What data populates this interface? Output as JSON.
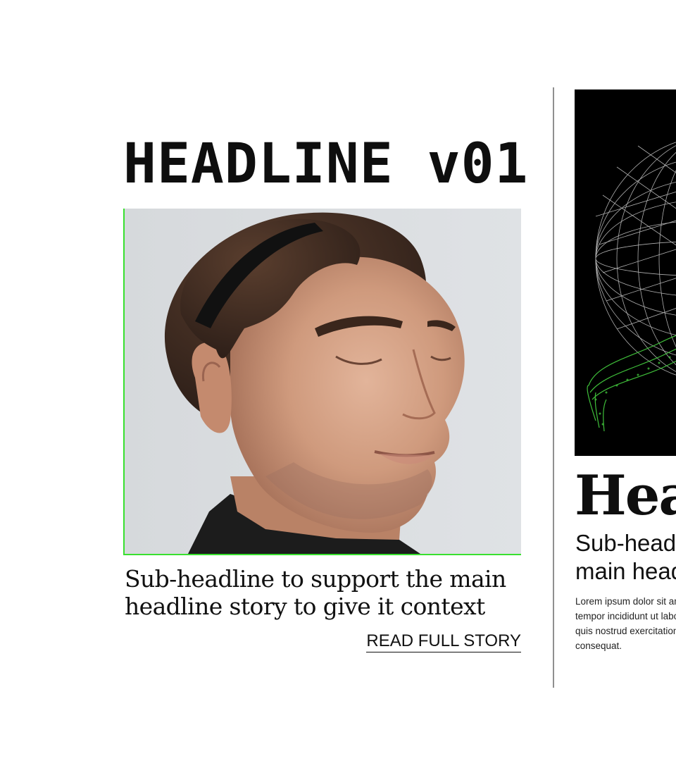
{
  "stories": [
    {
      "headline": "HEADLINE v01",
      "subheadline": "Sub-headline to support the main headline story to give it context",
      "link_label": "READ FULL STORY",
      "accent_color": "#39e02f"
    },
    {
      "headline": "Headline",
      "subheadline": "Sub-headline to support the main headline story",
      "body": "Lorem ipsum dolor sit amet, consectetur adipiscing elit, sed do eiusmod tempor incididunt ut labore et dolore magna aliqua. Ut enim ad minim veniam, quis nostrud exercitation ullamco laboris nisi ut aliquip ex ea commodo consequat.",
      "accent_color": "#3fbf3a"
    }
  ]
}
